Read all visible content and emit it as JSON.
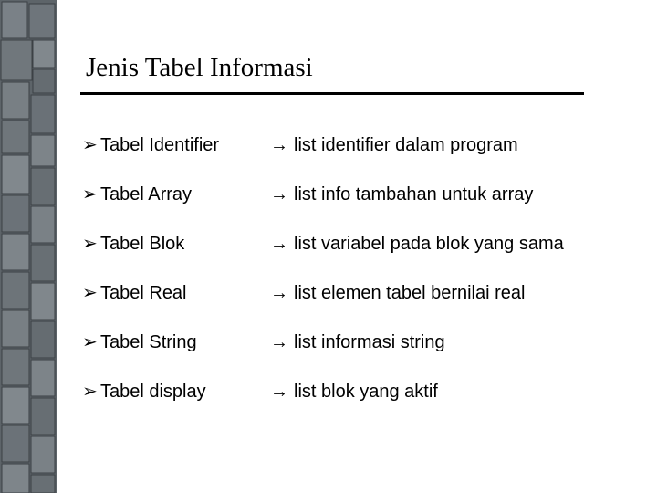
{
  "title": "Jenis Tabel Informasi",
  "bullet_glyph": "➢",
  "arrow_glyph": "→",
  "rows": [
    {
      "left": "Tabel Identifier",
      "right": "list identifier dalam program"
    },
    {
      "left": "Tabel Array",
      "right": "list info tambahan untuk array"
    },
    {
      "left": "Tabel Blok",
      "right": "list variabel pada blok yang sama"
    },
    {
      "left": "Tabel Real",
      "right": "list elemen tabel bernilai real"
    },
    {
      "left": "Tabel String",
      "right": "list informasi string"
    },
    {
      "left": "Tabel display",
      "right": "list blok yang aktif"
    }
  ]
}
